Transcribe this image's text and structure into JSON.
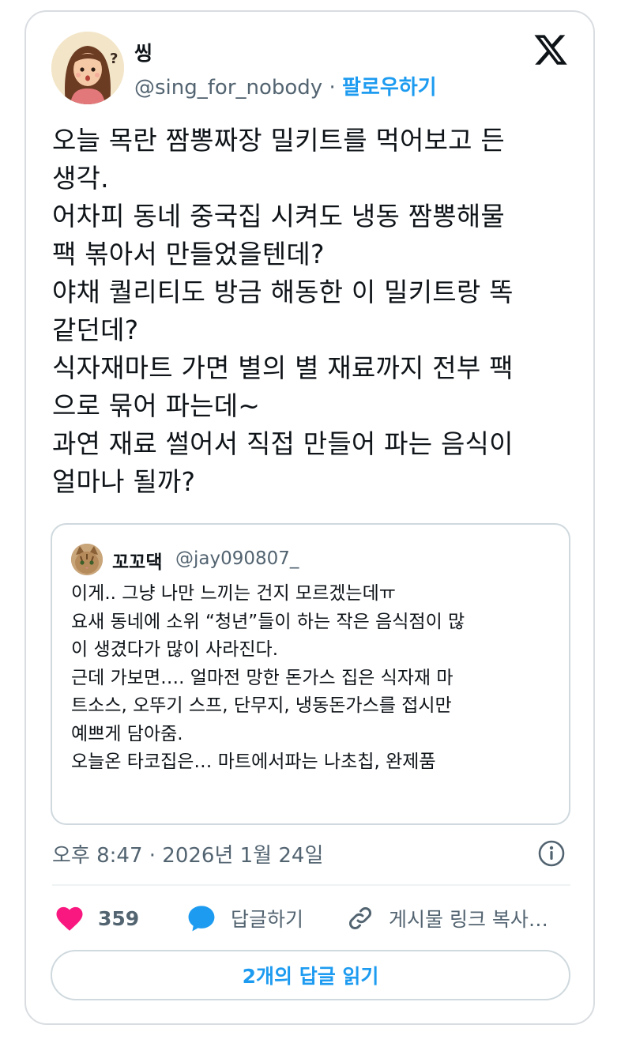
{
  "author": {
    "display_name": "씽",
    "handle": "@sing_for_nobody",
    "separator": " · ",
    "follow_label": "팔로우하기"
  },
  "tweet": {
    "text": "오늘 목란 짬뽕짜장 밀키트를 먹어보고 든\n생각.\n어차피 동네 중국집 시켜도 냉동 짬뽕해물\n팩 볶아서 만들었을텐데?\n야채 퀄리티도 방금 해동한 이 밀키트랑 똑\n같던데?\n식자재마트 가면 별의 별 재료까지 전부 팩\n으로 묶어 파는데~\n과연 재료 썰어서 직접 만들어 파는 음식이\n얼마나 될까?"
  },
  "quoted_tweet": {
    "display_name": "꼬꼬댁",
    "handle": "@jay090807_",
    "text": "이게.. 그냥 나만 느끼는 건지 모르겠는데ㅠ\n요새 동네에 소위 “청년”들이 하는 작은 음식점이 많\n이 생겼다가 많이 사라진다.\n근데 가보면…. 얼마전 망한 돈가스 집은 식자재 마\n트소스, 오뚜기 스프, 단무지, 냉동돈가스를 접시만\n예쁘게 담아줌.\n오늘온 타코집은… 마트에서파는 나초칩, 완제품"
  },
  "timestamp": "오후 8:47 · 2026년 1월 24일",
  "actions": {
    "like_count": "359",
    "reply_label": "답글하기",
    "copy_link_label": "게시물 링크 복사…"
  },
  "read_replies_label": "2개의 답글 읽기",
  "icons": {
    "brand": "x-logo-icon",
    "info": "info-icon",
    "like": "heart-icon",
    "reply": "speech-bubble-icon",
    "copy": "link-icon"
  },
  "colors": {
    "accent": "#1d9bf0",
    "like": "#f91880",
    "secondary_text": "#536471",
    "border": "#cfd9de"
  }
}
